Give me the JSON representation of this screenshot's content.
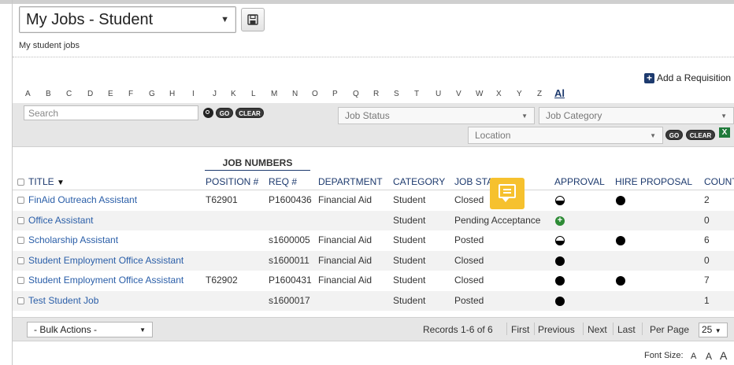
{
  "view": {
    "selected": "My Jobs - Student",
    "subtitle": "My student jobs"
  },
  "toolbar": {
    "add_requisition": "Add a Requisition"
  },
  "alphabet": [
    "A",
    "B",
    "C",
    "D",
    "E",
    "F",
    "G",
    "H",
    "I",
    "J",
    "K",
    "L",
    "M",
    "N",
    "O",
    "P",
    "Q",
    "R",
    "S",
    "T",
    "U",
    "V",
    "W",
    "X",
    "Y",
    "Z"
  ],
  "alphabet_all": "Al",
  "filters": {
    "search_placeholder": "Search",
    "go": "GO",
    "clear": "CLEAR",
    "job_status": "Job Status",
    "job_category": "Job Category",
    "location": "Location"
  },
  "table": {
    "group_header": "JOB NUMBERS",
    "columns": {
      "title": "TITLE",
      "position": "POSITION #",
      "req": "REQ #",
      "department": "DEPARTMENT",
      "category": "CATEGORY",
      "job_status": "JOB STATUS",
      "approval": "APPROVAL",
      "hire_proposal": "HIRE PROPOSAL",
      "count": "COUNT"
    },
    "rows": [
      {
        "title": "FinAid Outreach Assistant",
        "position": "T62901",
        "req": "P1600436",
        "department": "Financial Aid",
        "category": "Student",
        "status": "Closed",
        "approval": "half",
        "hire": "full",
        "count": "2"
      },
      {
        "title": "Office Assistant",
        "position": "",
        "req": "",
        "department": "",
        "category": "Student",
        "status": "Pending Acceptance",
        "approval": "plus",
        "hire": "none",
        "count": "0"
      },
      {
        "title": "Scholarship Assistant",
        "position": "",
        "req": "s1600005",
        "department": "Financial Aid",
        "category": "Student",
        "status": "Posted",
        "approval": "half",
        "hire": "full",
        "count": "6"
      },
      {
        "title": "Student Employment Office Assistant",
        "position": "",
        "req": "s1600011",
        "department": "Financial Aid",
        "category": "Student",
        "status": "Closed",
        "approval": "full",
        "hire": "none",
        "count": "0"
      },
      {
        "title": "Student Employment Office Assistant",
        "position": "T62902",
        "req": "P1600431",
        "department": "Financial Aid",
        "category": "Student",
        "status": "Closed",
        "approval": "full",
        "hire": "full",
        "count": "7"
      },
      {
        "title": "Test Student Job",
        "position": "",
        "req": "s1600017",
        "department": "",
        "category": "Student",
        "status": "Posted",
        "approval": "full",
        "hire": "none",
        "count": "1"
      }
    ]
  },
  "footer": {
    "bulk_actions": "- Bulk Actions -",
    "records": "Records 1-6 of 6",
    "first": "First",
    "previous": "Previous",
    "next": "Next",
    "last": "Last",
    "per_page_label": "Per Page",
    "per_page_value": "25"
  },
  "font_size": {
    "label": "Font Size:",
    "a": "A"
  }
}
